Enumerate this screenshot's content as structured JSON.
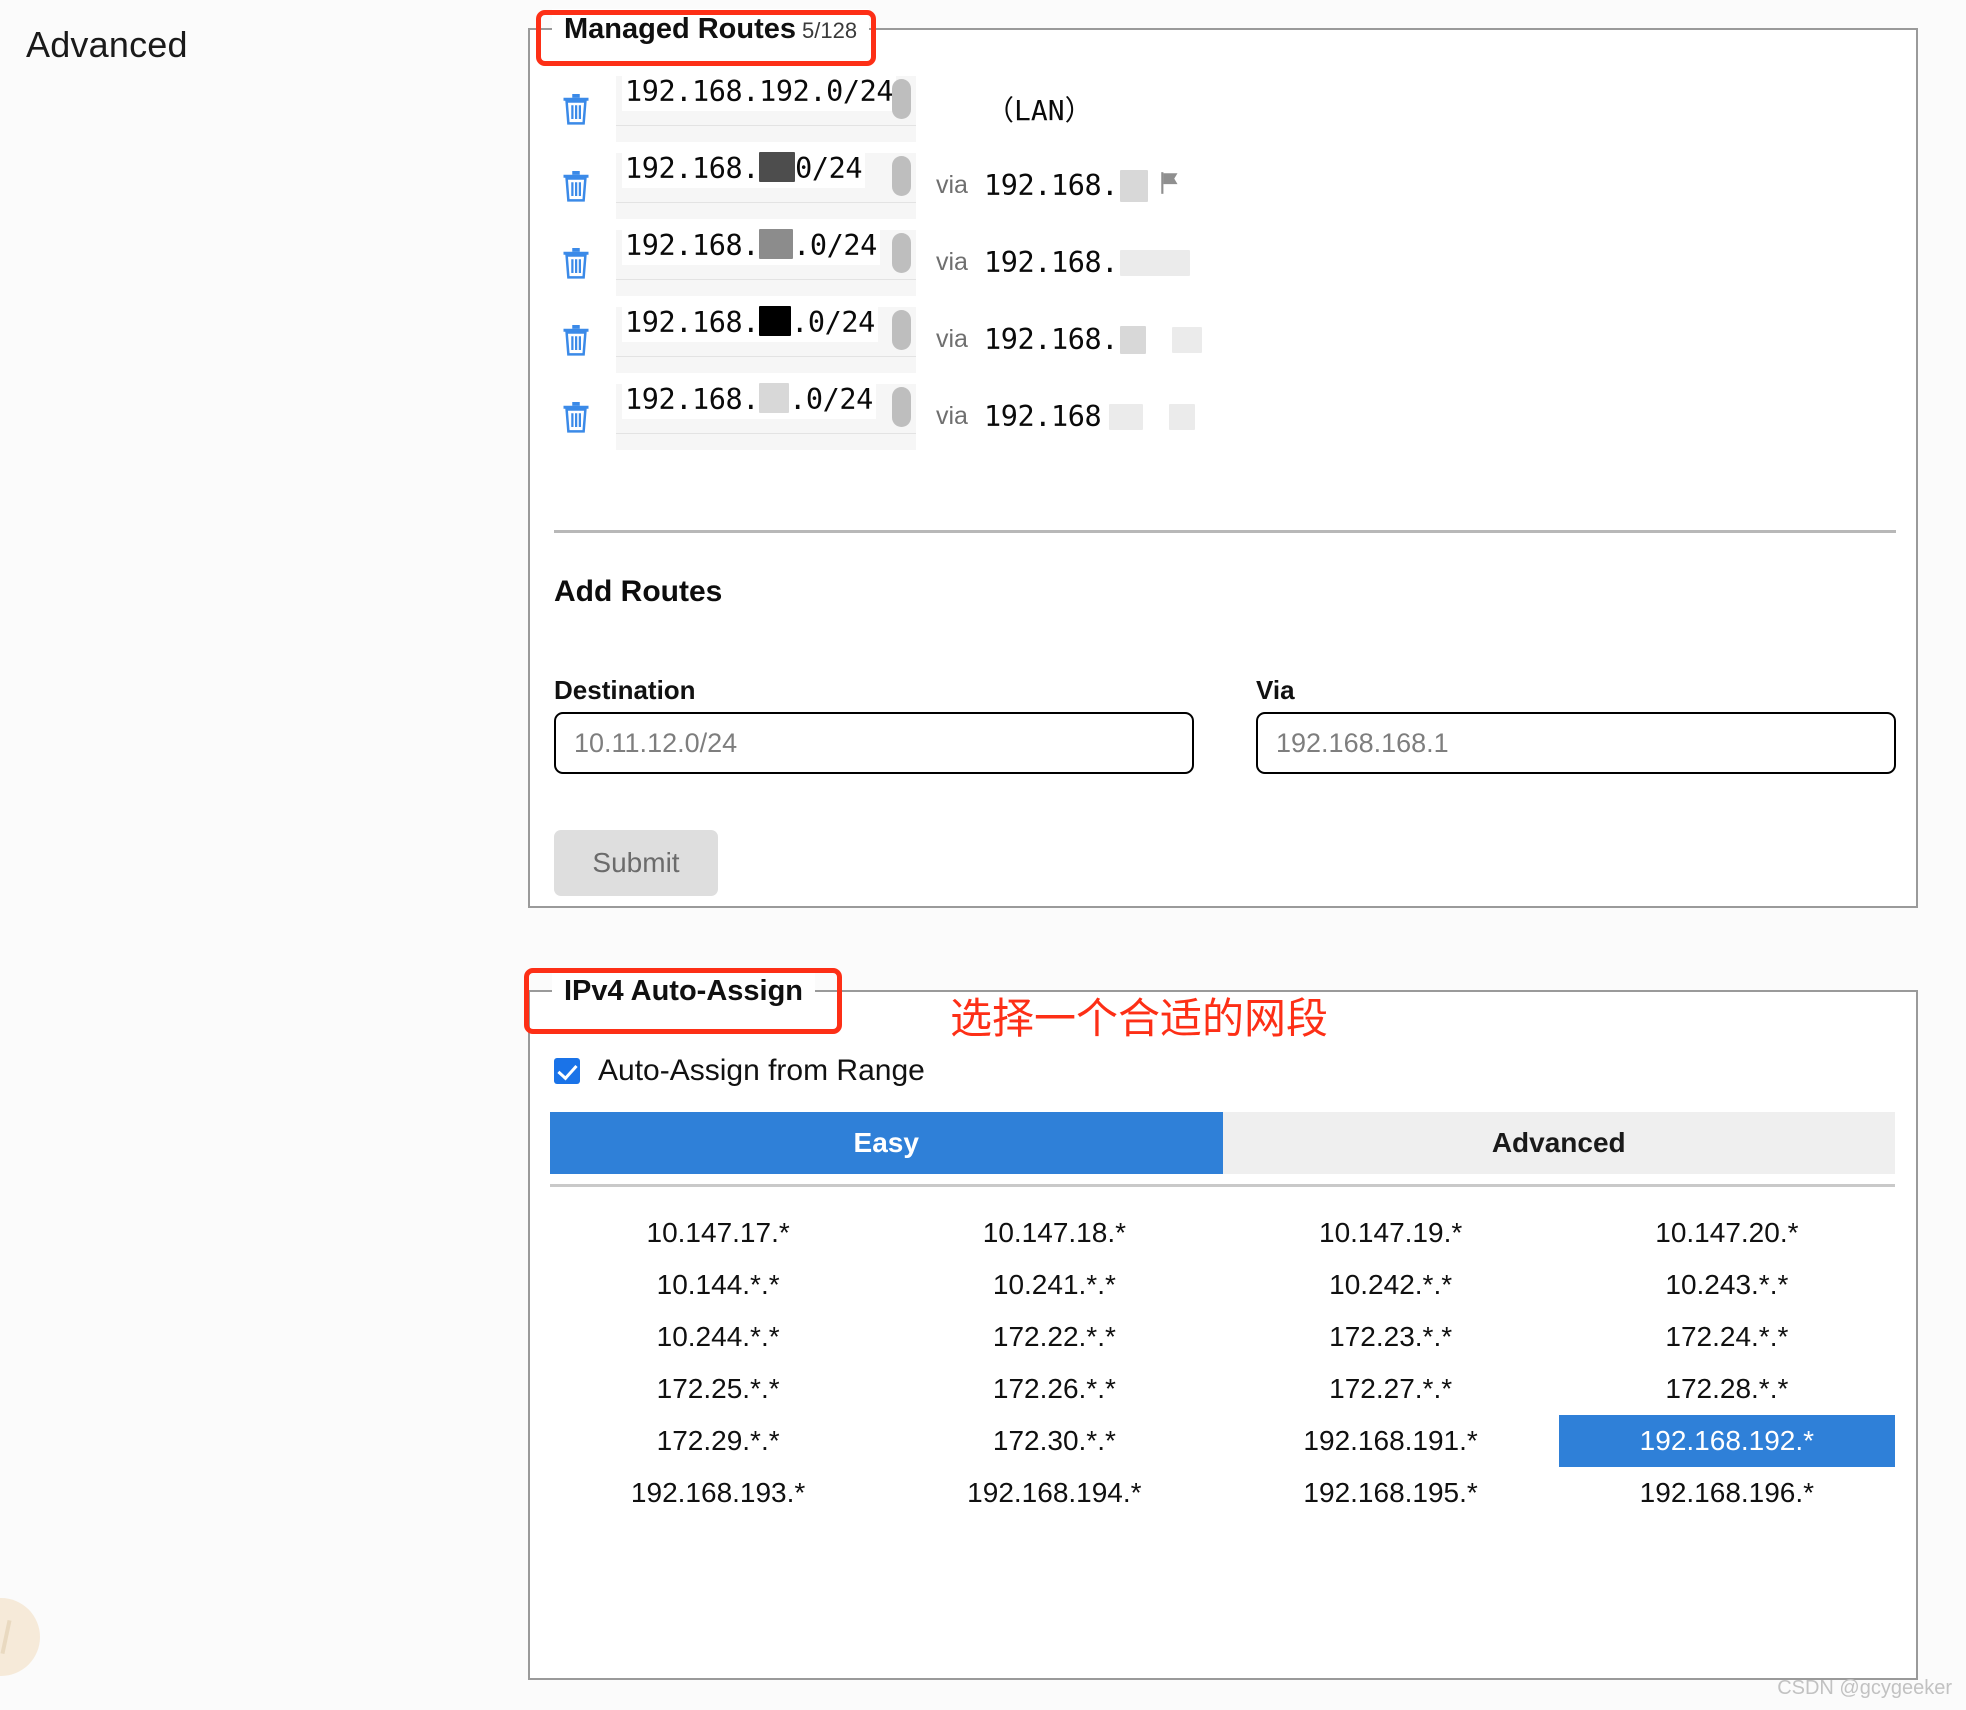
{
  "side_nav": {
    "label": "Advanced"
  },
  "routes_panel": {
    "title": "Managed Routes",
    "count": "5/128",
    "rows": [
      {
        "destination_prefix": "192.168.192.0/24",
        "destination_suffix": "",
        "mask_style": "none",
        "via_label": "",
        "via_prefix": "",
        "tag": "（LAN）"
      },
      {
        "destination_prefix": "192.168.",
        "destination_suffix": "0/24",
        "mask_style": "dark",
        "via_label": "via",
        "via_prefix": "192.168.",
        "tag": ""
      },
      {
        "destination_prefix": "192.168.",
        "destination_suffix": ".0/24",
        "mask_style": "mid",
        "via_label": "via",
        "via_prefix": "192.168.",
        "tag": ""
      },
      {
        "destination_prefix": "192.168.",
        "destination_suffix": ".0/24",
        "mask_style": "black",
        "via_label": "via",
        "via_prefix": "192.168.",
        "tag": ""
      },
      {
        "destination_prefix": "192.168.",
        "destination_suffix": ".0/24",
        "mask_style": "light",
        "via_label": "via",
        "via_prefix": "192.168",
        "tag": ""
      }
    ],
    "add_routes": {
      "title": "Add Routes",
      "destination_label": "Destination",
      "destination_placeholder": "10.11.12.0/24",
      "destination_value": "",
      "via_label": "Via",
      "via_placeholder": "192.168.168.1",
      "via_value": "",
      "submit_label": "Submit"
    }
  },
  "ipv4_panel": {
    "title": "IPv4 Auto-Assign",
    "annotation_cn": "选择一个合适的网段",
    "checkbox_label": "Auto-Assign from Range",
    "checkbox_checked": true,
    "tabs": [
      {
        "label": "Easy",
        "active": true
      },
      {
        "label": "Advanced",
        "active": false
      }
    ],
    "ranges": [
      "10.147.17.*",
      "10.147.18.*",
      "10.147.19.*",
      "10.147.20.*",
      "10.144.*.*",
      "10.241.*.*",
      "10.242.*.*",
      "10.243.*.*",
      "10.244.*.*",
      "172.22.*.*",
      "172.23.*.*",
      "172.24.*.*",
      "172.25.*.*",
      "172.26.*.*",
      "172.27.*.*",
      "172.28.*.*",
      "172.29.*.*",
      "172.30.*.*",
      "192.168.191.*",
      "192.168.192.*",
      "192.168.193.*",
      "192.168.194.*",
      "192.168.195.*",
      "192.168.196.*"
    ],
    "selected_range": "192.168.192.*"
  },
  "watermark": {
    "text": "CSDN @gcygeeker"
  },
  "colors": {
    "accent_blue": "#2f80d8",
    "checkbox_blue": "#1a73e8",
    "annotation_red": "#fd2f16",
    "trash_blue": "#3b8ae8",
    "panel_border": "#9a9a9a",
    "submit_disabled_bg": "#dedede"
  }
}
